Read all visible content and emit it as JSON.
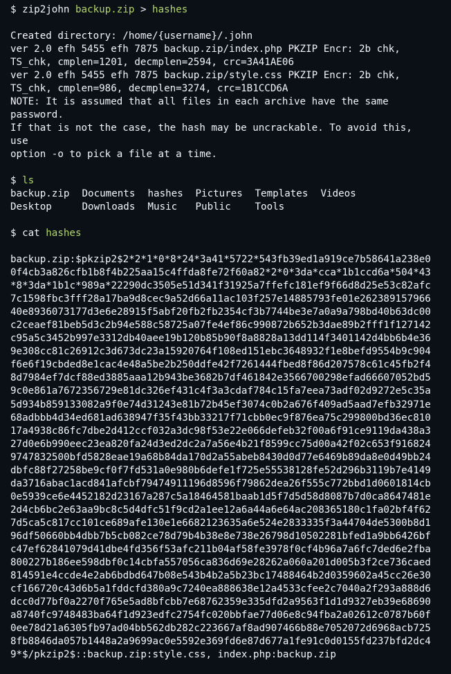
{
  "colors": {
    "background": "#0b1017",
    "text": "#f3f5f8",
    "accent_green": "#b3d66a"
  },
  "commands": {
    "zip2john": {
      "prompt": "$",
      "cmd": "zip2john",
      "arg1": "backup.zip",
      "redirect": ">",
      "arg2": "hashes"
    },
    "ls": {
      "prompt": "$",
      "cmd": "ls"
    },
    "cat": {
      "prompt": "$",
      "cmd": "cat",
      "arg": "hashes"
    }
  },
  "zip2john_output": [
    "Created directory: /home/{username}/.john",
    "ver 2.0 efh 5455 efh 7875 backup.zip/index.php PKZIP Encr: 2b chk,",
    "TS_chk, cmplen=1201, decmplen=2594, crc=3A41AE06",
    "ver 2.0 efh 5455 efh 7875 backup.zip/style.css PKZIP Encr: 2b chk,",
    "TS_chk, cmplen=986, decmplen=3274, crc=1B1CCD6A",
    "NOTE: It is assumed that all files in each archive have the same",
    "password.",
    "If that is not the case, the hash may be uncrackable. To avoid this,",
    "use",
    "option -o to pick a file at a time."
  ],
  "ls_output": {
    "row1": [
      "backup.zip",
      "Documents",
      "hashes",
      "Pictures",
      "Templates",
      "Videos"
    ],
    "row2": [
      "Desktop",
      "Downloads",
      "Music",
      "Public",
      "Tools"
    ]
  },
  "hash_output": [
    "backup.zip:$pkzip2$2*2*1*0*8*24*3a41*5722*543fb39ed1a919ce7b58641a238e0",
    "0f4cb3a826cfb1b8f4b225aa15c4ffda8fe72f60a82*2*0*3da*cca*1b1ccd6a*504*43",
    "*8*3da*1b1c*989a*22290dc3505e51d341f31925a7ffefc181ef9f66d8d25e53c82afc",
    "7c1598fbc3fff28a17ba9d8cec9a52d66a11ac103f257e14885793fe01e262389157966",
    "40e8936073177d3e6e28915f5abf20fb2fb2354cf3b7744be3e7a0a9a798bd40b63dc00",
    "c2ceaef81beb5d3c2b94e588c58725a07fe4ef86c990872b652b3dae89b2fff1f127142",
    "c95a5c3452b997e3312db40aee19b120b85b90f8a8828a13dd114f3401142d4bb6b4e36",
    "9e308cc81c26912c3d673dc23a15920764f108ed151ebc3648932f1e8befd9554b9c904",
    "f6e6f19cbded8e1cac4e48a5be2b250ddfe42f7261444fbed8f86d207578c61c45fb2f4",
    "8d7984ef7dcf88ed3885aaa12b943be3682b7df461842e3566700298efad66607052bd5",
    "9c0e861a7672356729e81dc326ef431c4f3a3cdaf784c15fa7eea73adf02d9272e5c35a",
    "5d934b859133082a9f0e74d31243e81b72b45ef3074c0b2a676f409ad5aad7efb32971e",
    "68adbbb4d34ed681ad638947f35f43bb33217f71cbb0ec9f876ea75c299800bd36ec810",
    "17a4938c86fc7dbe2d412ccf032a3dc98f53e22e066defeb32f00a6f91ce9119da438a3",
    "27d0e6b990eec23ea820fa24d3ed2dc2a7a56e4b21f8599cc75d00a42f02c653f916824",
    "9747832500bfd5828eae19a68b84da170d2a55abeb8430d0d77e6469b89da8e0d49bb24",
    "dbfc88f27258be9cf0f7fd531a0e980b6defe1f725e55538128fe52d296b3119b7e4149",
    "da3716abac1acd841afcbf79474911196d8596f79862dea26f555c772bbd1d0601814cb",
    "0e5939ce6e4452182d23167a287c5a18464581baab1d5f7d5d58d8087b7d0ca8647481e",
    "2d4cb6bc2e63aa9bc8c5d4dfc51f9cd2a1ee12a6a44a6e64ac208365180c1fa02bf4f62",
    "7d5ca5c817cc101ce689afe130e1e6682123635a6e524e2833335f3a44704de5300b8d1",
    "96df50660bb4dbb7b5cb082ce78d79b4b38e8e738e26798d10502281bfed1a9bb6426bf",
    "c47ef62841079d41dbe4fd356f53afc211b04af58fe3978f0cf4b96a7a6fc7ded6e2fba",
    "800227b186ee598dbf0c14cbfa557056ca836d69e28262a060a201d005b3f2ce736caed",
    "814591e4ccde4e2ab6bdbd647b08e543b4b2a5b23bc17488464b2d0359602a45cc26e30",
    "cf166720c43d6b5a1fddcfd380a9c7240ea888638e12a4533cfee2c7040a2f293a888d6",
    "dcc0d77bf0a2270f765e5ad8bfcbb7e68762359e335dfd2a9563f1d1d9327eb39e68690",
    "a8740fc9748483ba64f1d923edfc2754fc020bbfae77d06e8c94fba2a02612c0787b60f",
    "0ee78d21a6305fb97ad04bb562db282c223667af8ad907466b88e7052072d6968acb725",
    "8fb8846da057b1448a2a9699ac0e5592e369fd6e87d677a1fe91c0d0155fd237bfd2dc4",
    "9*$/pkzip2$::backup.zip:style.css, index.php:backup.zip"
  ]
}
